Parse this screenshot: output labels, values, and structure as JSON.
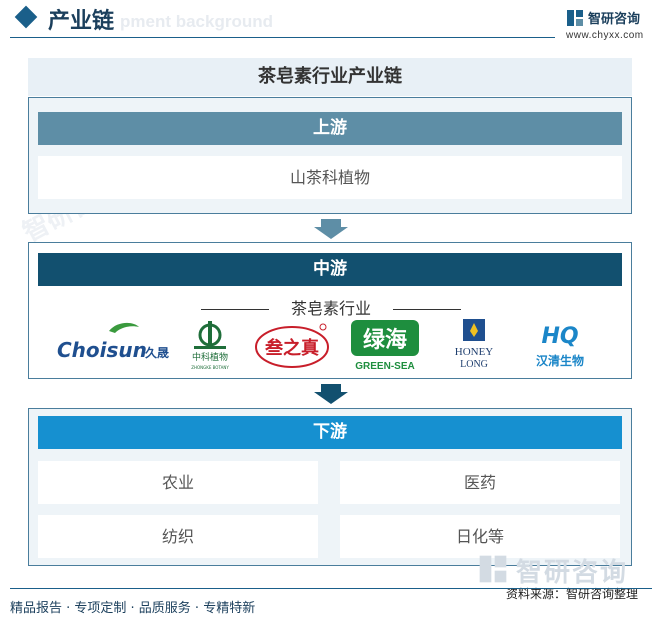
{
  "header": {
    "title": "产业链",
    "ghost_text": "pment background",
    "brand_name": "智研咨询",
    "brand_url": "www.chyxx.com"
  },
  "diagram": {
    "title": "茶皂素行业产业链",
    "upstream": {
      "label": "上游",
      "items": [
        "山茶科植物"
      ]
    },
    "midstream": {
      "label": "中游",
      "industry": "茶皂素行业",
      "logos": [
        {
          "icon": "choisun-logo",
          "text": "Choisun",
          "sub": "久晟"
        },
        {
          "icon": "zhongke-botany-logo",
          "text": "中科植物",
          "sub": "ZHONGKE BOTANY"
        },
        {
          "icon": "sanzhizhen-logo",
          "text": "叁之真"
        },
        {
          "icon": "green-sea-logo",
          "text": "绿海",
          "sub": "GREEN-SEA"
        },
        {
          "icon": "honey-long-logo",
          "text": "HONEY",
          "sub": "LONG"
        },
        {
          "icon": "hanqing-logo",
          "text": "HQ",
          "sub": "汉清生物"
        }
      ]
    },
    "downstream": {
      "label": "下游",
      "items": [
        "农业",
        "医药",
        "纺织",
        "日化等"
      ]
    }
  },
  "footer": {
    "tagline": "精品报告 · 专项定制 · 品质服务 · 专精特新",
    "source": "资料来源：智研咨询整理",
    "watermark": "智研咨询"
  },
  "colors": {
    "upstream_band": "#5e8ea6",
    "midstream_band": "#12506f",
    "downstream_band": "#1690d0",
    "accent": "#1a5f8a"
  }
}
